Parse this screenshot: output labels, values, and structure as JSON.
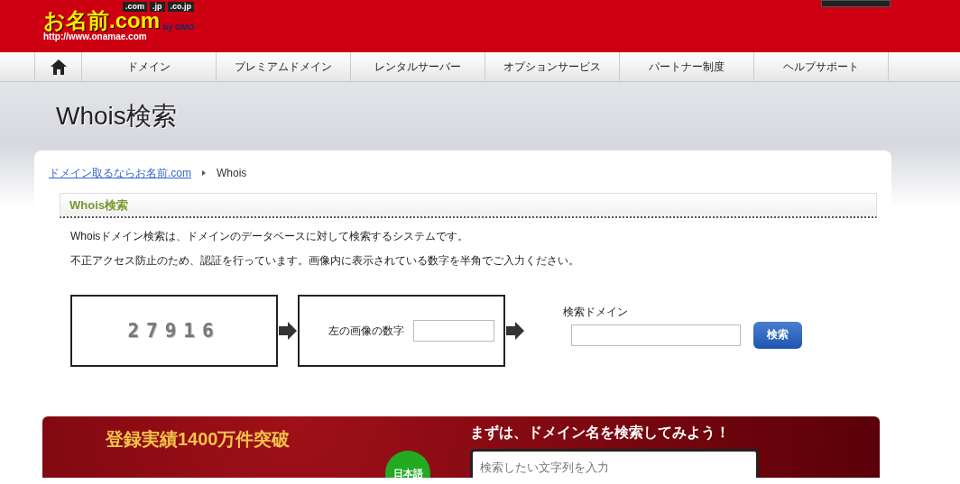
{
  "header": {
    "logo": "お名前.com",
    "logo_domains": [
      ".com",
      ".jp",
      ".co.jp"
    ],
    "logo_url": "http://www.onamae.com",
    "logo_by": "by GMO"
  },
  "nav": [
    {
      "kind": "home",
      "selected": false
    },
    {
      "label": "ドメイン",
      "selected": false
    },
    {
      "label": "プレミアムドメイン",
      "selected": false
    },
    {
      "label": "レンタルサーバー",
      "selected": false
    },
    {
      "label": "オプションサービス",
      "selected": false
    },
    {
      "label": "パートナー制度",
      "selected": false
    },
    {
      "label": "ヘルプサポート",
      "selected": false
    }
  ],
  "page_title": "Whois検索",
  "breadcrumb": [
    {
      "label": "ドメイン取るならお名前.com",
      "kind": "link"
    },
    {
      "label": "Whois",
      "kind": "current"
    }
  ],
  "section_title": "Whois検索",
  "paragraphs": [
    "Whoisドメイン検索は、ドメインのデータベースに対して検索するシステムです。",
    "不正アクセス防止のため、認証を行っています。画像内に表示されている数字を半角でご入力ください。"
  ],
  "captcha": "27916",
  "captcha_label": "左の画像の数字",
  "domain_label": "検索ドメイン",
  "search_button": "検索",
  "banner": {
    "headline": "登録実績1400万件突破",
    "badge": "日本語",
    "prompt": "まずは、ドメイン名を検索してみよう！",
    "placeholder": "検索したい文字列を入力"
  }
}
